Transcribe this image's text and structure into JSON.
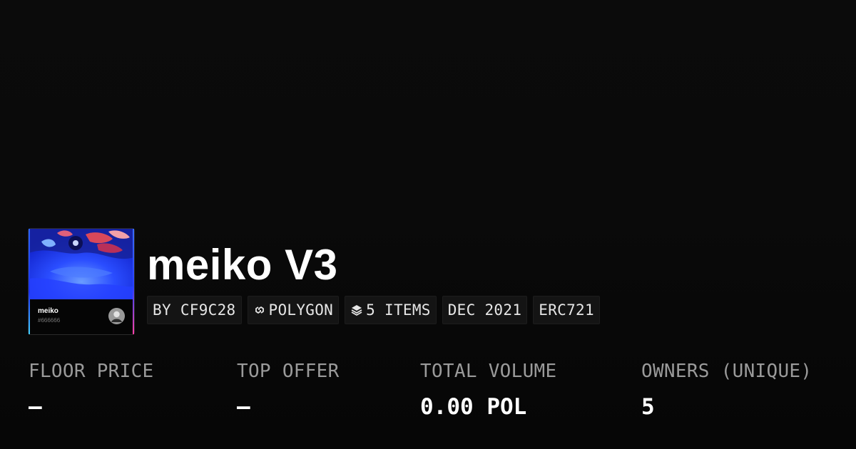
{
  "collection": {
    "title": "meiko V3",
    "card": {
      "name": "meiko",
      "subtitle": "#666666",
      "accent_left": "#2a63ff",
      "accent_right": "#ff40a8",
      "artwork_color": "#1f3cff"
    },
    "tags": [
      {
        "icon": "",
        "label": "BY CF9C28"
      },
      {
        "icon": "polygon-link-icon",
        "label": "POLYGON"
      },
      {
        "icon": "layers-icon",
        "label": "5 ITEMS"
      },
      {
        "icon": "",
        "label": "DEC 2021"
      },
      {
        "icon": "",
        "label": "ERC721"
      }
    ]
  },
  "stats": [
    {
      "label": "FLOOR PRICE",
      "value": "–"
    },
    {
      "label": "TOP OFFER",
      "value": "–"
    },
    {
      "label": "TOTAL VOLUME",
      "value": "0.00 POL"
    },
    {
      "label": "OWNERS (UNIQUE)",
      "value": "5"
    }
  ],
  "colors": {
    "background": "#0a0a0a",
    "tag_background": "#141414",
    "label": "#9a9a9a",
    "value": "#ffffff"
  }
}
